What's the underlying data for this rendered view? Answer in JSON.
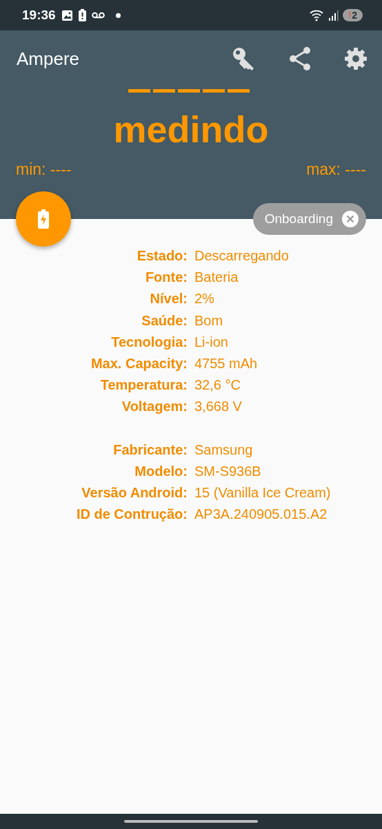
{
  "status_bar": {
    "time": "19:36",
    "notification_alert": "!",
    "notification_count": "2"
  },
  "toolbar": {
    "title": "Ampere"
  },
  "meter": {
    "reading": "—————",
    "status": "medindo",
    "min": "min: ----",
    "max": "max: ----"
  },
  "chip": {
    "label": "Onboarding"
  },
  "info_groups": [
    {
      "rows": [
        {
          "label": "Estado:",
          "value": "Descarregando"
        },
        {
          "label": "Fonte:",
          "value": "Bateria"
        },
        {
          "label": "Nível:",
          "value": "2%"
        },
        {
          "label": "Saúde:",
          "value": "Bom"
        },
        {
          "label": "Tecnologia:",
          "value": "Li-ion"
        },
        {
          "label": "Max. Capacity:",
          "value": "4755 mAh"
        },
        {
          "label": "Temperatura:",
          "value": "32,6 °C"
        },
        {
          "label": "Voltagem:",
          "value": "3,668 V"
        }
      ]
    },
    {
      "rows": [
        {
          "label": "Fabricante:",
          "value": "Samsung"
        },
        {
          "label": "Modelo:",
          "value": "SM-S936B"
        },
        {
          "label": "Versão Android:",
          "value": "15 (Vanilla Ice Cream)"
        },
        {
          "label": "ID de Contrução:",
          "value": "AP3A.240905.015.A2"
        }
      ]
    }
  ]
}
